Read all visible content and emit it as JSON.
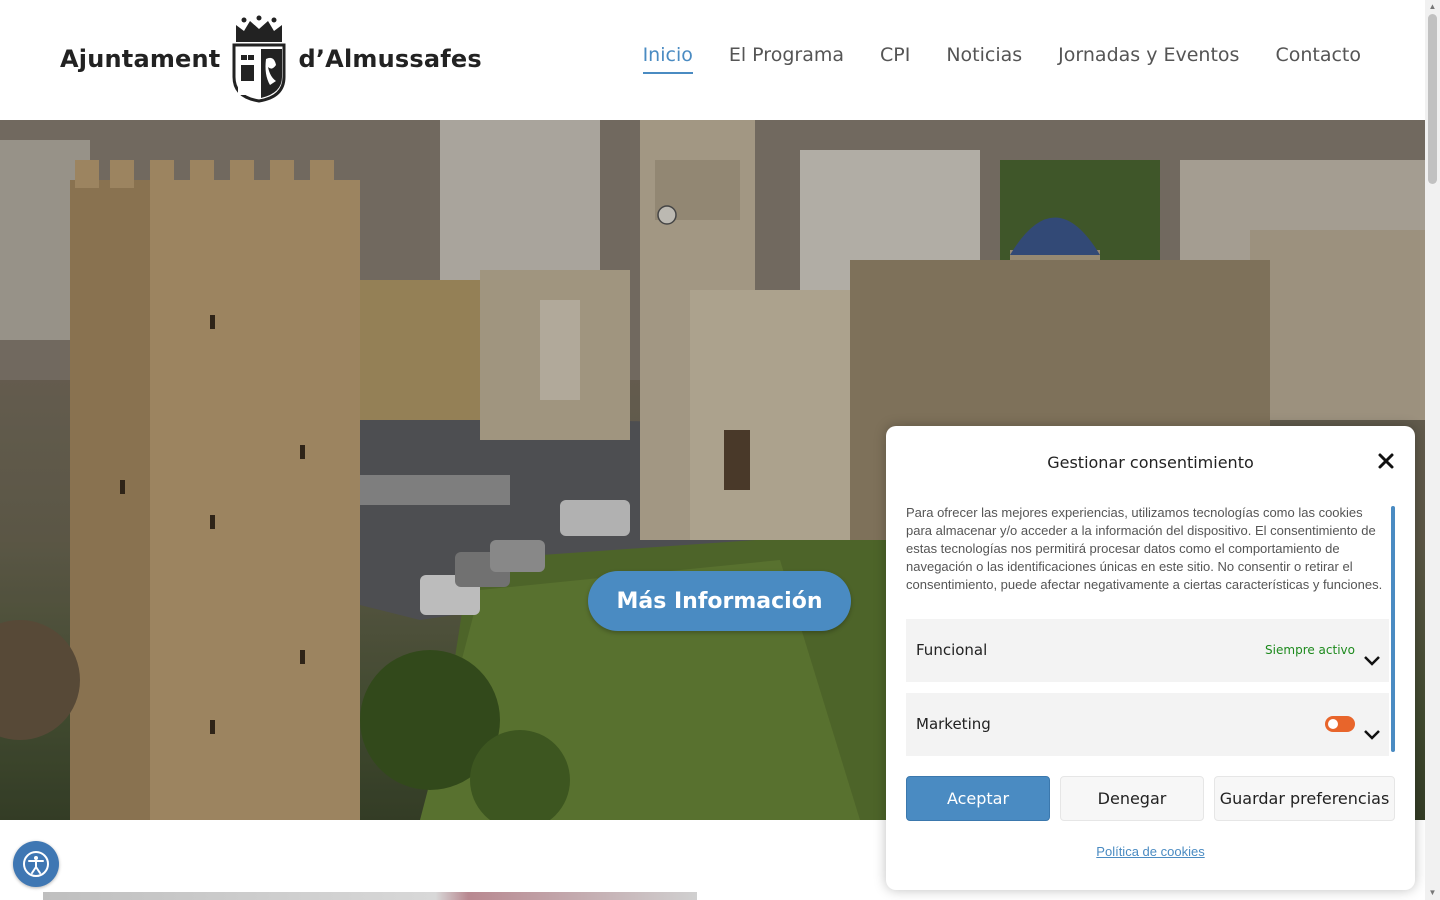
{
  "logo": {
    "left_text": "Ajuntament",
    "right_text": "d’Almussafes"
  },
  "nav": {
    "items": [
      {
        "label": "Inicio",
        "active": true
      },
      {
        "label": "El Programa"
      },
      {
        "label": "CPI"
      },
      {
        "label": "Noticias"
      },
      {
        "label": "Jornadas y Eventos"
      },
      {
        "label": "Contacto"
      }
    ]
  },
  "hero": {
    "cta_label": "Más Información"
  },
  "cookie_modal": {
    "title": "Gestionar consentimiento",
    "body": "Para ofrecer las mejores experiencias, utilizamos tecnologías como las cookies para almacenar y/o acceder a la información del dispositivo. El consentimiento de estas tecnologías nos permitirá procesar datos como el comportamiento de navegación o las identificaciones únicas en este sitio. No consentir o retirar el consentimiento, puede afectar negativamente a ciertas características y funciones.",
    "preferences": {
      "funcional": {
        "label": "Funcional",
        "status": "Siempre activo"
      },
      "marketing": {
        "label": "Marketing",
        "enabled": false
      }
    },
    "buttons": {
      "accept": "Aceptar",
      "deny": "Denegar",
      "save": "Guardar preferencias"
    },
    "policy_link": "Política de cookies"
  },
  "icons": {
    "close": "close-icon",
    "chevron": "chevron-down-icon",
    "accessibility": "accessibility-icon",
    "crest": "coat-of-arms-icon"
  },
  "colors": {
    "accent": "#4a8bc2",
    "toggle_off": "#e8652b",
    "always_active": "#1d8a1d"
  }
}
